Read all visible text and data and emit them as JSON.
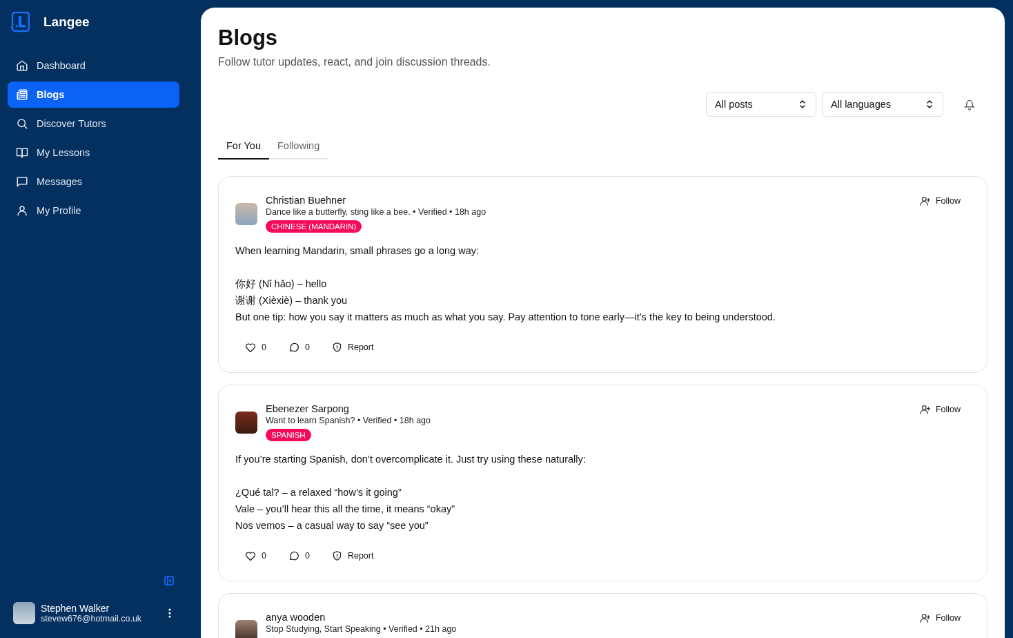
{
  "brand": {
    "name": "Langee"
  },
  "sidebar": {
    "items": [
      {
        "label": "Dashboard",
        "selected": false
      },
      {
        "label": "Blogs",
        "selected": true
      },
      {
        "label": "Discover Tutors",
        "selected": false
      },
      {
        "label": "My Lessons",
        "selected": false
      },
      {
        "label": "Messages",
        "selected": false
      },
      {
        "label": "My Profile",
        "selected": false
      }
    ]
  },
  "user": {
    "name": "Stephen Walker",
    "email": "stevew676@hotmail.co.uk"
  },
  "page": {
    "title": "Blogs",
    "subtitle": "Follow tutor updates, react, and join discussion threads."
  },
  "filters": [
    {
      "value": "All posts"
    },
    {
      "value": "All languages"
    }
  ],
  "tabs": [
    {
      "label": "For You",
      "selected": true
    },
    {
      "label": "Following",
      "selected": false
    }
  ],
  "posts": [
    {
      "author": "Christian Buehner",
      "meta": "Dance like a butterfly, sting like a bee. • Verified • 18h ago",
      "tag": "CHINESE (MANDARIN)",
      "follow": "Follow",
      "paragraphs": [
        [
          "When learning Mandarin, small phrases go a long way:"
        ],
        [
          "你好 (Nǐ hǎo) – hello",
          "谢谢 (Xièxiè) – thank you",
          "But one tip: how you say it matters as much as what you say. Pay attention to tone early—it’s the key to being understood."
        ]
      ],
      "likes": "0",
      "comments": "0",
      "report": "Report"
    },
    {
      "author": "Ebenezer Sarpong",
      "meta": "Want to learn Spanish? • Verified • 18h ago",
      "tag": "SPANISH",
      "follow": "Follow",
      "paragraphs": [
        [
          "If you’re starting Spanish, don’t overcomplicate it. Just try using these naturally:"
        ],
        [
          "¿Qué tal? – a relaxed “how’s it going”",
          "Vale – you’ll hear this all the time, it means “okay”",
          "Nos vemos – a casual way to say “see you”"
        ]
      ],
      "likes": "0",
      "comments": "0",
      "report": "Report"
    },
    {
      "author": "anya wooden",
      "meta": "Stop Studying, Start Speaking • Verified • 21h ago",
      "follow": "Follow"
    }
  ]
}
